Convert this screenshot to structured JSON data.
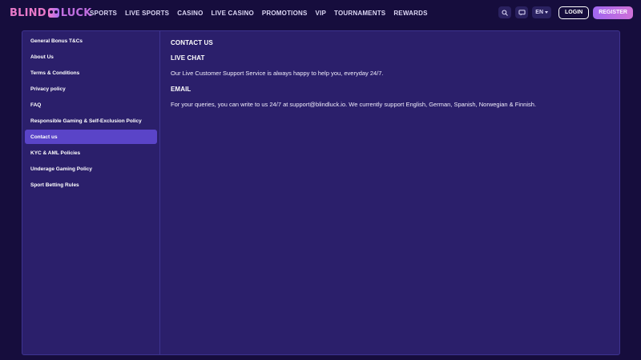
{
  "brand": {
    "part1": "BLIND",
    "part2": "LUCK",
    "mark_icon": "dice-mask-icon"
  },
  "nav": [
    "SPORTS",
    "LIVE SPORTS",
    "CASINO",
    "LIVE CASINO",
    "PROMOTIONS",
    "VIP",
    "TOURNAMENTS",
    "REWARDS"
  ],
  "header": {
    "search_icon": "search-icon",
    "chat_icon": "chat-icon",
    "language": "EN",
    "login_label": "LOGIN",
    "register_label": "REGISTER"
  },
  "sidebar": {
    "items": [
      {
        "label": "General Bonus T&Cs"
      },
      {
        "label": "About Us"
      },
      {
        "label": "Terms & Conditions"
      },
      {
        "label": "Privacy policy"
      },
      {
        "label": "FAQ"
      },
      {
        "label": "Responsible Gaming & Self-Exclusion Policy"
      },
      {
        "label": "Contact us",
        "active": true
      },
      {
        "label": "KYC & AML Policies"
      },
      {
        "label": "Underage Gaming Policy"
      },
      {
        "label": "Sport Betting Rules"
      }
    ]
  },
  "content": {
    "title": "CONTACT US",
    "live_chat_heading": "LIVE CHAT",
    "live_chat_text": "Our Live Customer Support Service is always happy to help you, everyday 24/7.",
    "email_heading": "EMAIL",
    "email_text": "For your queries, you can write to us 24/7 at support@blindluck.io. We currently support English, German, Spanish, Norwegian & Finnish."
  },
  "colors": {
    "background": "#160d3d",
    "panel": "#2b1f6b",
    "active_item": "#5a44c8",
    "brand_pink": "#e879c9",
    "brand_purple": "#a66ff2"
  }
}
